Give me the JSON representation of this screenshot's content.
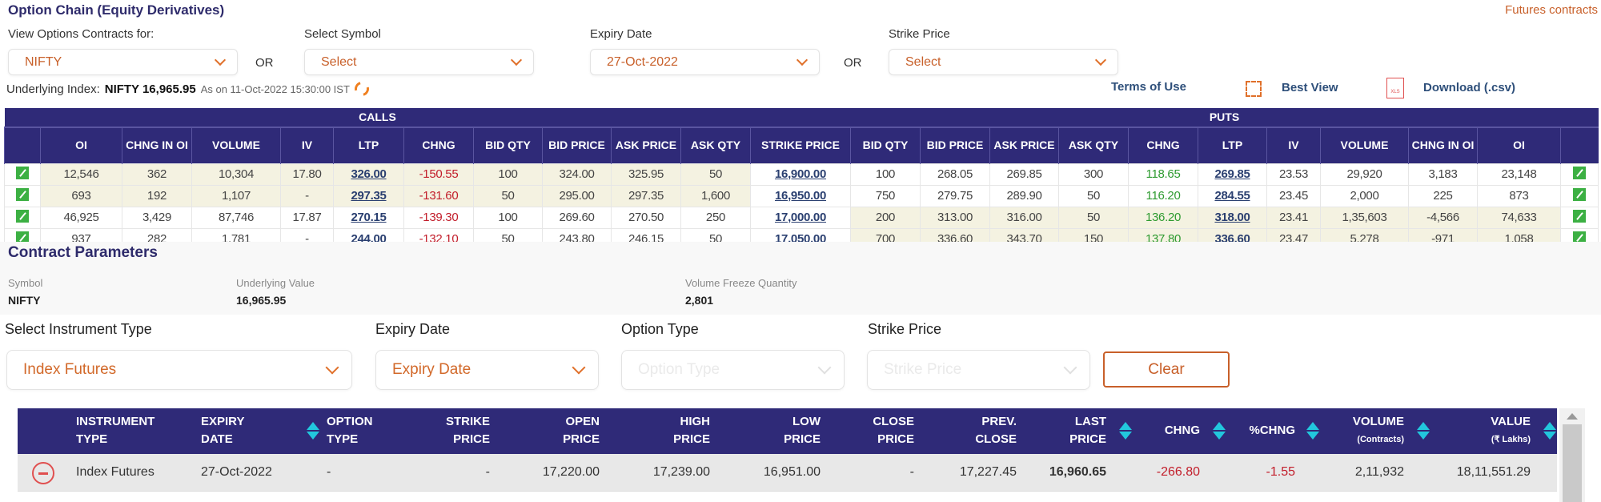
{
  "header": {
    "title": "Option Chain (Equity Derivatives)",
    "futures_link": "Futures contracts"
  },
  "filters": {
    "view_label": "View Options Contracts for:",
    "view_value": "NIFTY",
    "or": "OR",
    "symbol_label": "Select Symbol",
    "symbol_value": "Select",
    "expiry_label": "Expiry Date",
    "expiry_value": "27-Oct-2022",
    "strike_label": "Strike Price",
    "strike_value": "Select"
  },
  "underlying": {
    "label": "Underlying Index:",
    "value": "NIFTY 16,965.95",
    "as_on": "As on 11-Oct-2022 15:30:00 IST"
  },
  "tools": {
    "terms": "Terms of Use",
    "best_view": "Best View",
    "download": "Download (.csv)",
    "xls_icon_text": "XLS"
  },
  "option_chain": {
    "calls_label": "CALLS",
    "puts_label": "PUTS",
    "columns": [
      "OI",
      "CHNG IN OI",
      "VOLUME",
      "IV",
      "LTP",
      "CHNG",
      "BID QTY",
      "BID PRICE",
      "ASK PRICE",
      "ASK QTY",
      "STRIKE PRICE",
      "BID QTY",
      "BID PRICE",
      "ASK PRICE",
      "ASK QTY",
      "CHNG",
      "LTP",
      "IV",
      "VOLUME",
      "CHNG IN OI",
      "OI"
    ],
    "rows": [
      [
        "12,546",
        "362",
        "10,304",
        "17.80",
        "326.00",
        "-150.55",
        "100",
        "324.00",
        "325.95",
        "50",
        "16,900.00",
        "100",
        "268.05",
        "269.85",
        "300",
        "118.65",
        "269.85",
        "23.53",
        "29,920",
        "3,183",
        "23,148"
      ],
      [
        "693",
        "192",
        "1,107",
        "-",
        "297.35",
        "-131.60",
        "50",
        "295.00",
        "297.35",
        "1,600",
        "16,950.00",
        "750",
        "279.75",
        "289.90",
        "50",
        "116.20",
        "284.55",
        "23.45",
        "2,000",
        "225",
        "873"
      ],
      [
        "46,925",
        "3,429",
        "87,746",
        "17.87",
        "270.15",
        "-139.30",
        "100",
        "269.60",
        "270.50",
        "250",
        "17,000.00",
        "200",
        "313.00",
        "316.00",
        "50",
        "136.20",
        "318.00",
        "23.41",
        "1,35,603",
        "-4,566",
        "74,633"
      ],
      [
        "937",
        "282",
        "1,781",
        "-",
        "244.00",
        "-132.10",
        "50",
        "243.80",
        "246.15",
        "50",
        "17,050.00",
        "700",
        "336.60",
        "343.70",
        "150",
        "137.80",
        "336.60",
        "23.47",
        "5,278",
        "-971",
        "1,058"
      ]
    ],
    "calls_itm_rows": [
      0,
      1
    ],
    "puts_itm_rows": [
      2,
      3
    ]
  },
  "contract_parameters": {
    "title": "Contract Parameters",
    "symbol_label": "Symbol",
    "symbol_value": "NIFTY",
    "underlying_label": "Underlying Value",
    "underlying_value": "16,965.95",
    "freeze_label": "Volume Freeze Quantity",
    "freeze_value": "2,801"
  },
  "futures_filters": {
    "instrument_label": "Select Instrument Type",
    "instrument_value": "Index Futures",
    "expiry_label": "Expiry Date",
    "expiry_value": "Expiry Date",
    "option_type_label": "Option Type",
    "option_type_placeholder": "Option Type",
    "strike_label": "Strike Price",
    "strike_placeholder": "Strike Price",
    "clear": "Clear"
  },
  "futures_table": {
    "headers": {
      "instrument": [
        "INSTRUMENT",
        "TYPE"
      ],
      "expiry": [
        "EXPIRY",
        "DATE"
      ],
      "option_type": [
        "OPTION",
        "TYPE"
      ],
      "strike": [
        "STRIKE",
        "PRICE"
      ],
      "open": [
        "OPEN",
        "PRICE"
      ],
      "high": [
        "HIGH",
        "PRICE"
      ],
      "low": [
        "LOW",
        "PRICE"
      ],
      "close": [
        "CLOSE",
        "PRICE"
      ],
      "prev_close": [
        "PREV.",
        "CLOSE"
      ],
      "last": [
        "LAST",
        "PRICE"
      ],
      "chng": "CHNG",
      "pchng": "%CHNG",
      "volume": [
        "VOLUME",
        "(Contracts)"
      ],
      "value": [
        "VALUE",
        "(₹ Lakhs)"
      ]
    },
    "row": {
      "instrument": "Index Futures",
      "expiry": "27-Oct-2022",
      "option_type": "-",
      "strike": "-",
      "open": "17,220.00",
      "high": "17,239.00",
      "low": "16,951.00",
      "close": "-",
      "prev_close": "17,227.45",
      "last": "16,960.65",
      "chng": "-266.80",
      "pchng": "-1.55",
      "volume": "2,11,932",
      "value": "18,11,551.29"
    }
  },
  "colors": {
    "header_bg": "#2f2a78",
    "accent": "#e0702a",
    "negative": "#c21d2a",
    "positive": "#2e9b30",
    "itm_bg": "#f4f2e1",
    "sort_arrow": "#22c7dd"
  }
}
